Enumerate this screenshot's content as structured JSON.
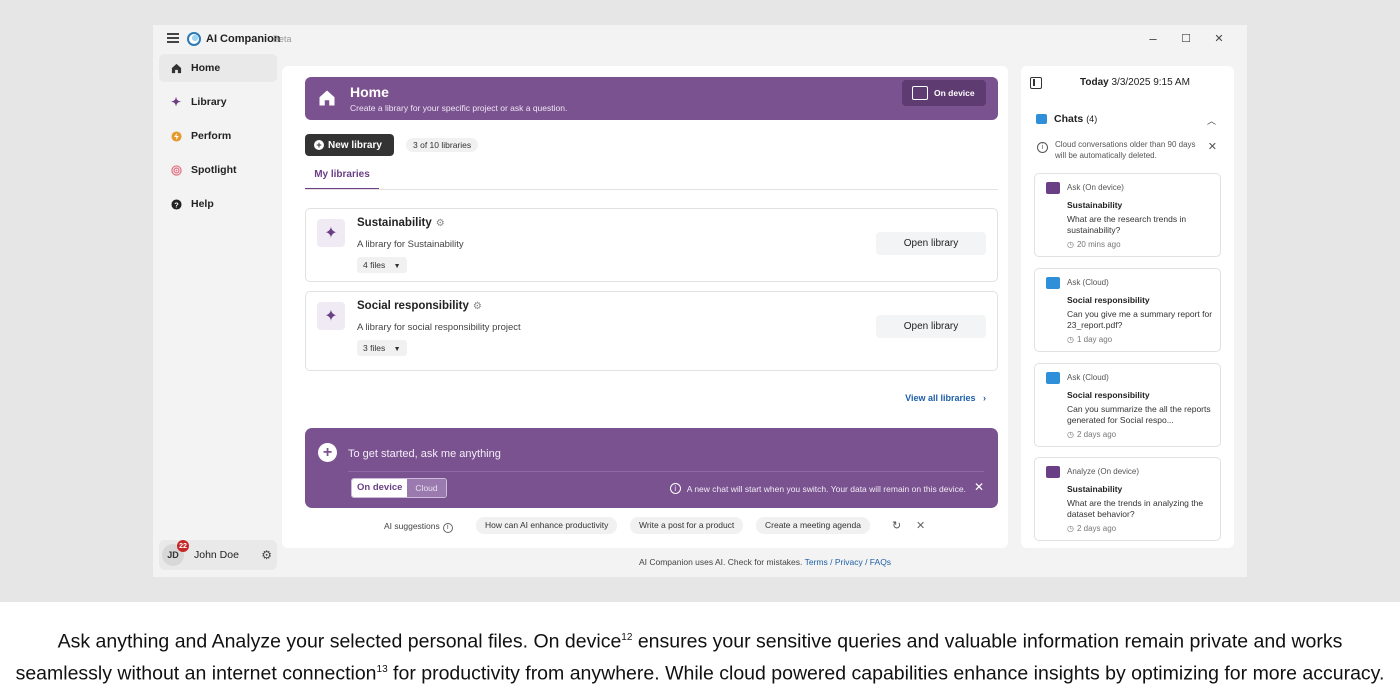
{
  "app": {
    "title": "AI Companion",
    "beta": "Beta"
  },
  "window_controls": {
    "minimize": "–",
    "maximize": "☐",
    "close": "✕"
  },
  "sidebar": {
    "items": [
      {
        "label": "Home",
        "icon": "home-icon",
        "active": true
      },
      {
        "label": "Library",
        "icon": "sparkle-icon"
      },
      {
        "label": "Perform",
        "icon": "bolt-icon"
      },
      {
        "label": "Spotlight",
        "icon": "target-icon"
      },
      {
        "label": "Help",
        "icon": "help-icon"
      }
    ],
    "user": {
      "initials": "JD",
      "badge": "22",
      "name": "John Doe"
    }
  },
  "hero": {
    "title": "Home",
    "subtitle": "Create a library for your specific project or ask a question.",
    "mode": "On device"
  },
  "libraries": {
    "new_button": "New library",
    "count": "3 of 10 libraries",
    "tab": "My libraries",
    "items": [
      {
        "name": "Sustainability",
        "description": "A library for Sustainability",
        "files": "4 files",
        "action": "Open library"
      },
      {
        "name": "Social responsibility",
        "description": "A library for social responsibility project",
        "files": "3 files",
        "action": "Open library"
      }
    ],
    "view_all": "View all libraries"
  },
  "ask": {
    "placeholder": "To get started, ask me anything",
    "mode_on": "On device",
    "mode_off": "Cloud",
    "info": "A new chat will start when you switch. Your data will remain on this device."
  },
  "suggestions": {
    "label": "AI suggestions",
    "chips": [
      "How can AI enhance productivity",
      "Write a post for a product",
      "Create a meeting agenda"
    ]
  },
  "footer": {
    "text": "AI Companion uses AI. Check for mistakes.",
    "links": "Terms / Privacy / FAQs"
  },
  "right_panel": {
    "today_label": "Today",
    "today_value": "3/3/2025  9:15 AM",
    "chats_title": "Chats",
    "chats_count": "(4)",
    "notice": "Cloud conversations older than 90 days will be automatically deleted.",
    "chats": [
      {
        "type": "Ask (On device)",
        "title": "Sustainability",
        "question": "What are the research trends in sustainability?",
        "ago": "20 mins ago",
        "color": "#6b3f86"
      },
      {
        "type": "Ask (Cloud)",
        "title": "Social responsibility",
        "question": "Can you give me a summary report for 23_report.pdf?",
        "ago": "1 day ago",
        "color": "#2f8fd8"
      },
      {
        "type": "Ask (Cloud)",
        "title": "Social responsibility",
        "question": "Can you summarize the all the reports generated for Social respo...",
        "ago": "2 days ago",
        "color": "#2f8fd8"
      },
      {
        "type": "Analyze (On device)",
        "title": "Sustainability",
        "question": "What are the trends in analyzing the dataset behavior?",
        "ago": "2 days ago",
        "color": "#6b3f86"
      }
    ]
  },
  "caption": {
    "line1_a": "Ask anything and Analyze your selected personal files. On device",
    "sup1": "12",
    "line1_b": " ensures your sensitive queries and valuable information remain private and works",
    "line2_a": "seamlessly without an internet connection",
    "sup2": "13",
    "line2_b": " for productivity from anywhere. While cloud powered capabilities enhance insights by optimizing for more accuracy."
  },
  "colors": {
    "accent": "#7a5290",
    "accent_dark": "#6b3f86",
    "link": "#1d5fa8",
    "cloud": "#2f8fd8"
  }
}
